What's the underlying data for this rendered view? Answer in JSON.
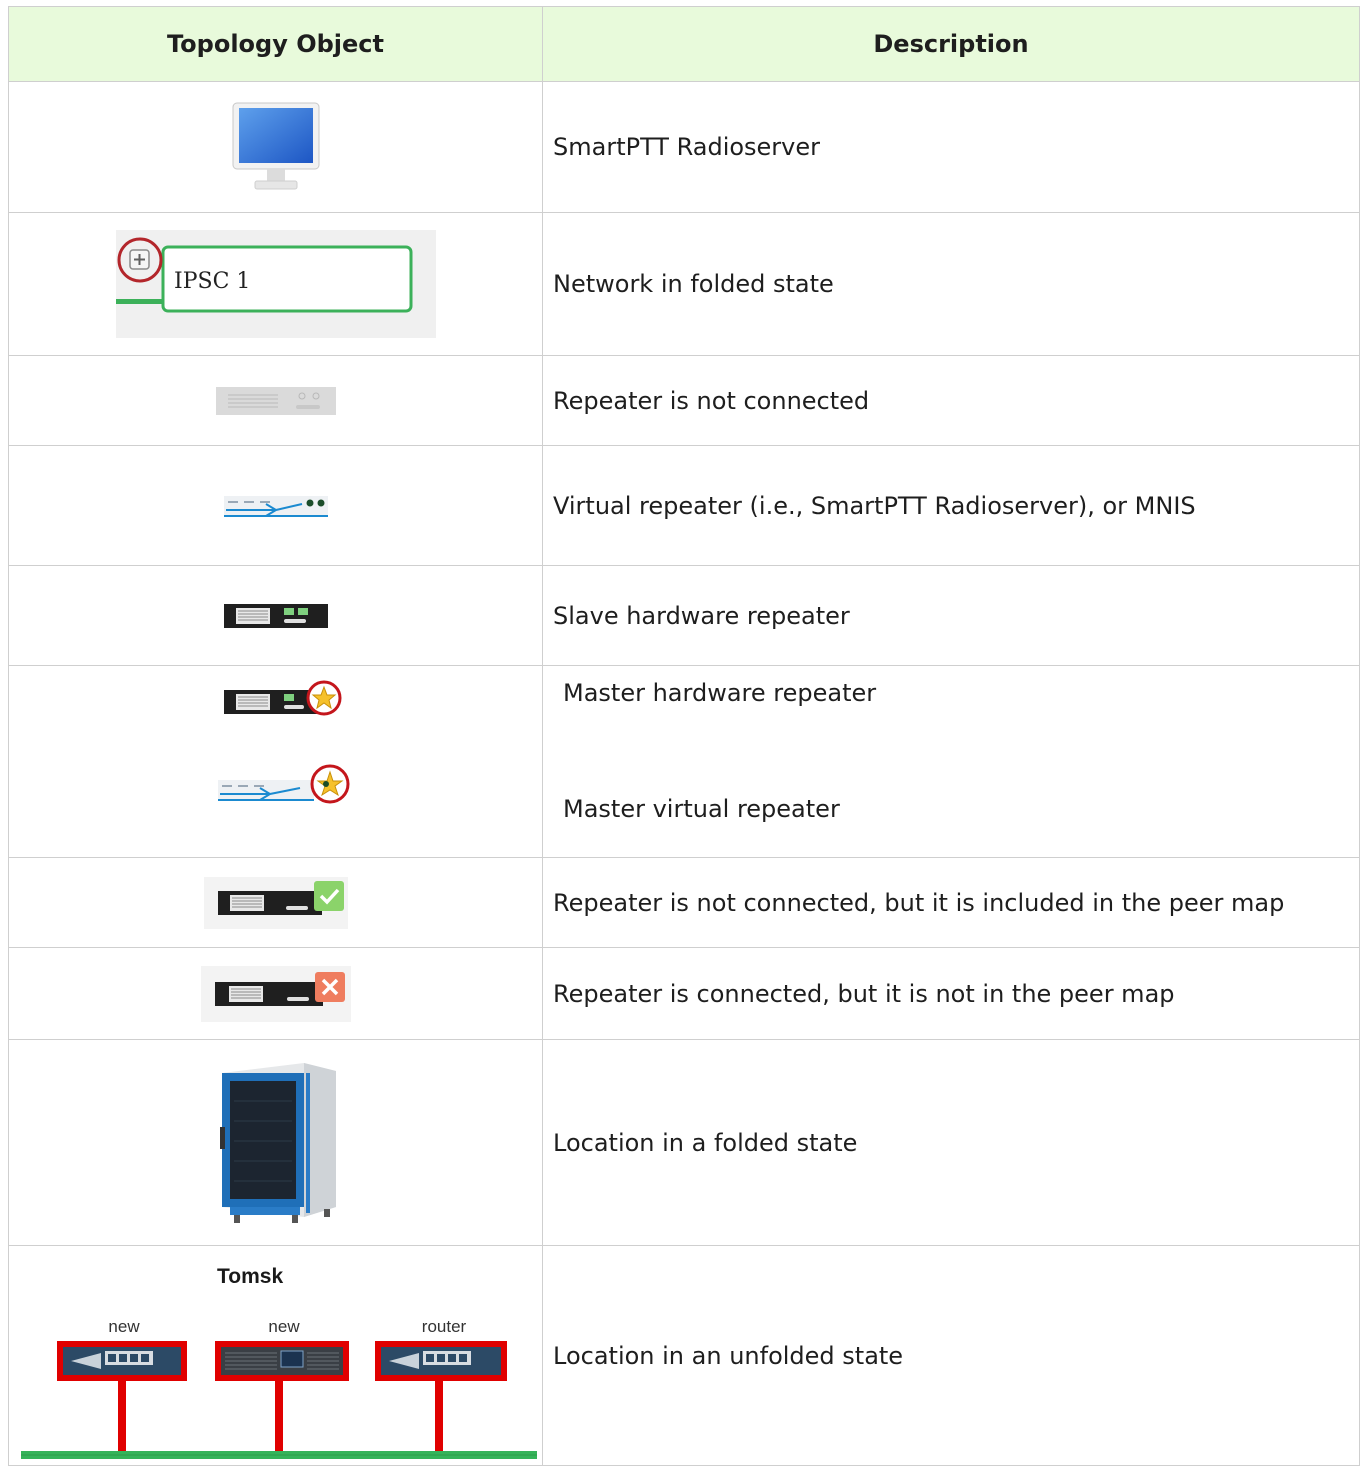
{
  "header": {
    "col_object": "Topology Object",
    "col_description": "Description"
  },
  "rows": [
    {
      "description": "SmartPTT Radioserver",
      "icon": "monitor-icon"
    },
    {
      "description": "Network in folded state",
      "icon": "network-folded-icon",
      "label": "IPSC 1"
    },
    {
      "description": "Repeater is not connected",
      "icon": "repeater-disconnected-icon"
    },
    {
      "description": "Virtual repeater (i.e., SmartPTT Radioserver), or MNIS",
      "icon": "virtual-repeater-icon"
    },
    {
      "description": "Slave hardware repeater",
      "icon": "slave-repeater-icon"
    },
    {
      "description": "Master hardware repeater",
      "icon": "master-hardware-repeater-icon"
    },
    {
      "description": "Master virtual repeater",
      "icon": "master-virtual-repeater-icon"
    },
    {
      "description": "Repeater is not connected, but it is included in the peer map",
      "icon": "repeater-in-peer-map-icon"
    },
    {
      "description": "Repeater is connected, but it is not in the peer map",
      "icon": "repeater-not-in-peer-map-icon"
    },
    {
      "description": "Location in a folded state",
      "icon": "server-cabinet-icon"
    },
    {
      "description": "Location in an unfolded state",
      "icon": "location-unfolded-icon"
    }
  ],
  "location": {
    "title": "Tomsk",
    "devices": [
      "new",
      "new",
      "router"
    ]
  },
  "colors": {
    "header_bg": "#e8fadb",
    "border": "#cfcfcf",
    "accent_green": "#3cb15a",
    "alert_red": "#e00000"
  }
}
